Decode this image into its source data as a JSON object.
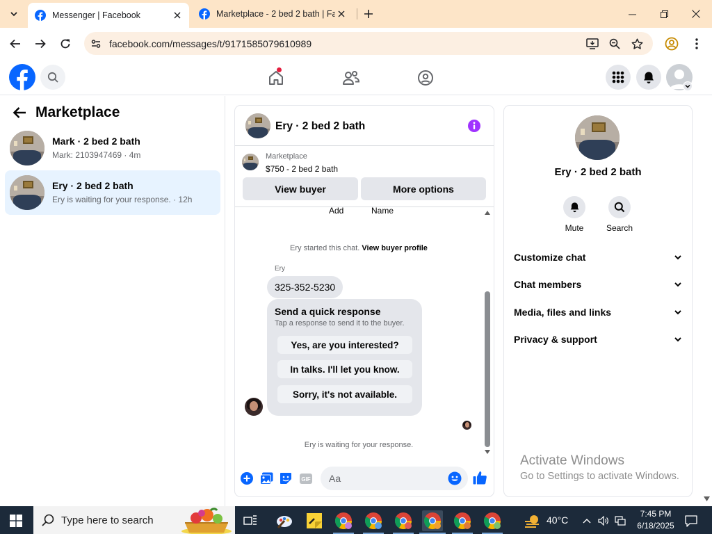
{
  "browser": {
    "tabs": [
      {
        "title": "Messenger | Facebook",
        "active": true
      },
      {
        "title": "Marketplace - 2 bed 2 bath | Fa",
        "active": false
      }
    ],
    "url": "facebook.com/messages/t/9171585079610989"
  },
  "marketplace": {
    "title": "Marketplace",
    "conversations": [
      {
        "name": "Mark · 2 bed 2 bath",
        "preview": "Mark: 2103947469 · 4m",
        "selected": false
      },
      {
        "name": "Ery · 2 bed 2 bath",
        "preview": "Ery is waiting for your response. · 12h",
        "selected": true
      }
    ]
  },
  "chat": {
    "title": "Ery · 2 bed 2 bath",
    "listing": {
      "category": "Marketplace",
      "price_title": "$750 - 2 bed 2 bath",
      "view_buyer": "View buyer",
      "more_options": "More options"
    },
    "truncated_labels": [
      "Add",
      "Name"
    ],
    "system_started": "Ery started this chat.",
    "view_buyer_profile": "View buyer profile",
    "sender": "Ery",
    "message": "325-352-5230",
    "quick_response": {
      "title": "Send a quick response",
      "subtitle": "Tap a response to send it to the buyer.",
      "options": [
        "Yes, are you interested?",
        "In talks. I'll let you know.",
        "Sorry, it's not available."
      ]
    },
    "waiting": "Ery is waiting for your response.",
    "composer_placeholder": "Aa"
  },
  "details": {
    "name": "Ery · 2 bed 2 bath",
    "actions": [
      {
        "label": "Mute"
      },
      {
        "label": "Search"
      }
    ],
    "sections": [
      "Customize chat",
      "Chat members",
      "Media, files and links",
      "Privacy & support"
    ]
  },
  "watermark": {
    "line1": "Activate Windows",
    "line2": "Go to Settings to activate Windows."
  },
  "taskbar": {
    "search_placeholder": "Type here to search",
    "temperature": "40°C",
    "time": "7:45 PM",
    "date": "6/18/2025"
  },
  "colors": {
    "facebook_blue": "#0866ff",
    "messenger_purple": "#a033ff",
    "selected_bg": "#e7f3ff",
    "titlebar": "#fde5c8"
  }
}
